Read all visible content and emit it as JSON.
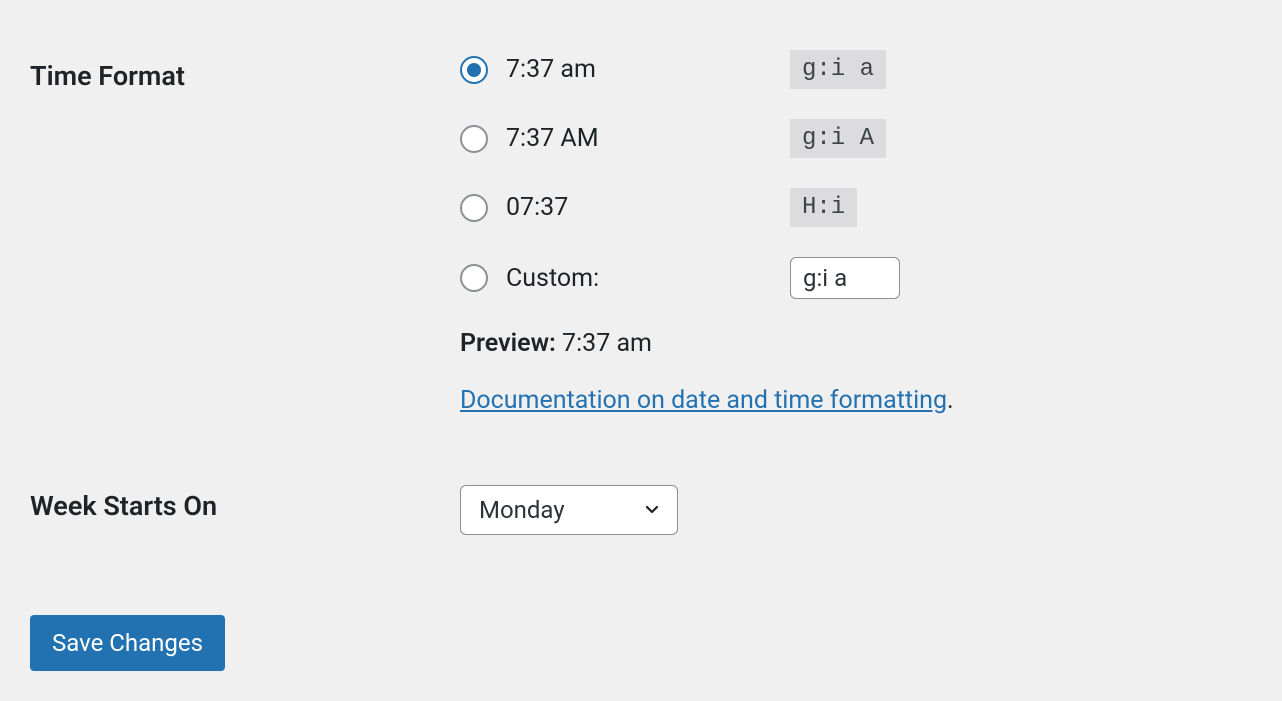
{
  "time_format": {
    "label": "Time Format",
    "options": [
      {
        "display": "7:37 am",
        "code": "g:i a",
        "checked": true
      },
      {
        "display": "7:37 AM",
        "code": "g:i A",
        "checked": false
      },
      {
        "display": "07:37",
        "code": "H:i",
        "checked": false
      }
    ],
    "custom_label": "Custom:",
    "custom_value": "g:i a",
    "preview_label": "Preview:",
    "preview_value": "7:37 am",
    "doc_link_text": "Documentation on date and time formatting",
    "doc_link_suffix": "."
  },
  "week_starts": {
    "label": "Week Starts On",
    "value": "Monday"
  },
  "submit": {
    "label": "Save Changes"
  }
}
